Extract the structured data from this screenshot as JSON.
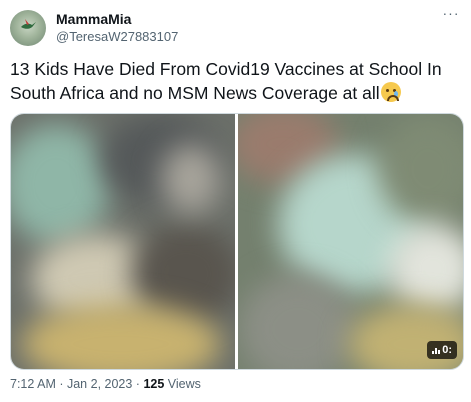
{
  "author": {
    "display_name": "MammaMia",
    "handle": "@TeresaW27883107"
  },
  "more_icon": "more-horizontal-icon",
  "tweet": {
    "text": "13 Kids Have Died From Covid19 Vaccines at School In South Africa and no MSM News Coverage at all",
    "emoji": "crying-face-emoji"
  },
  "media": {
    "badge_text": "0:"
  },
  "meta": {
    "time": "7:12 AM",
    "sep1": " · ",
    "date": "Jan 2, 2023",
    "sep2": " · ",
    "views_count": "125",
    "views_label": " Views"
  }
}
